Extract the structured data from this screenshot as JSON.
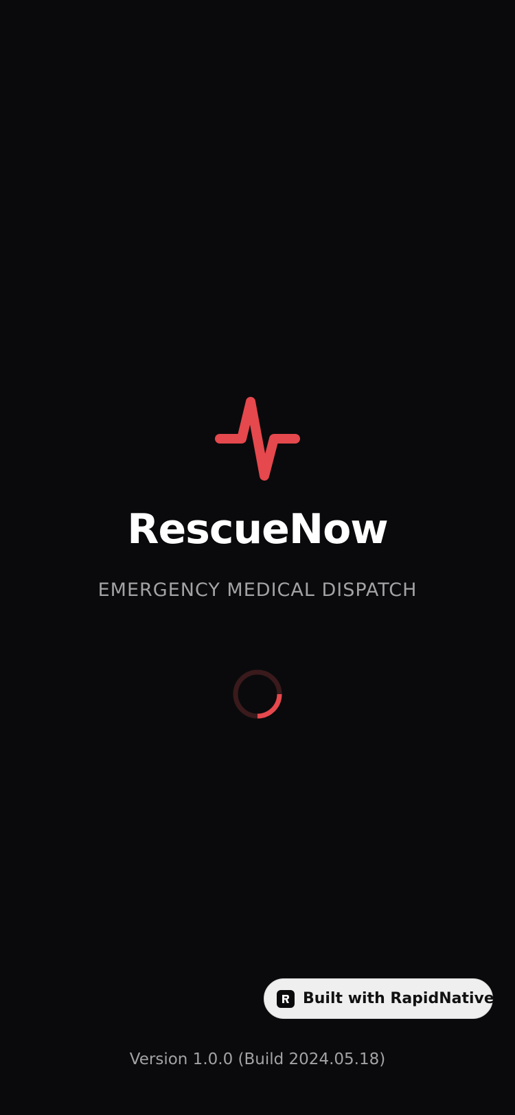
{
  "app": {
    "name": "RescueNow",
    "tagline": "EMERGENCY MEDICAL DISPATCH",
    "logo_icon": "heartbeat-pulse-icon",
    "accent_color": "#e5484d",
    "background_color": "#0a0a0c"
  },
  "loading": {
    "indicator": "spinner-icon",
    "track_color": "#3a1a1c",
    "arc_color": "#e5484d"
  },
  "badge": {
    "label": "Built with RapidNative",
    "icon": "rapidnative-logo-icon"
  },
  "footer": {
    "version_text": "Version 1.0.0 (Build 2024.05.18)"
  }
}
